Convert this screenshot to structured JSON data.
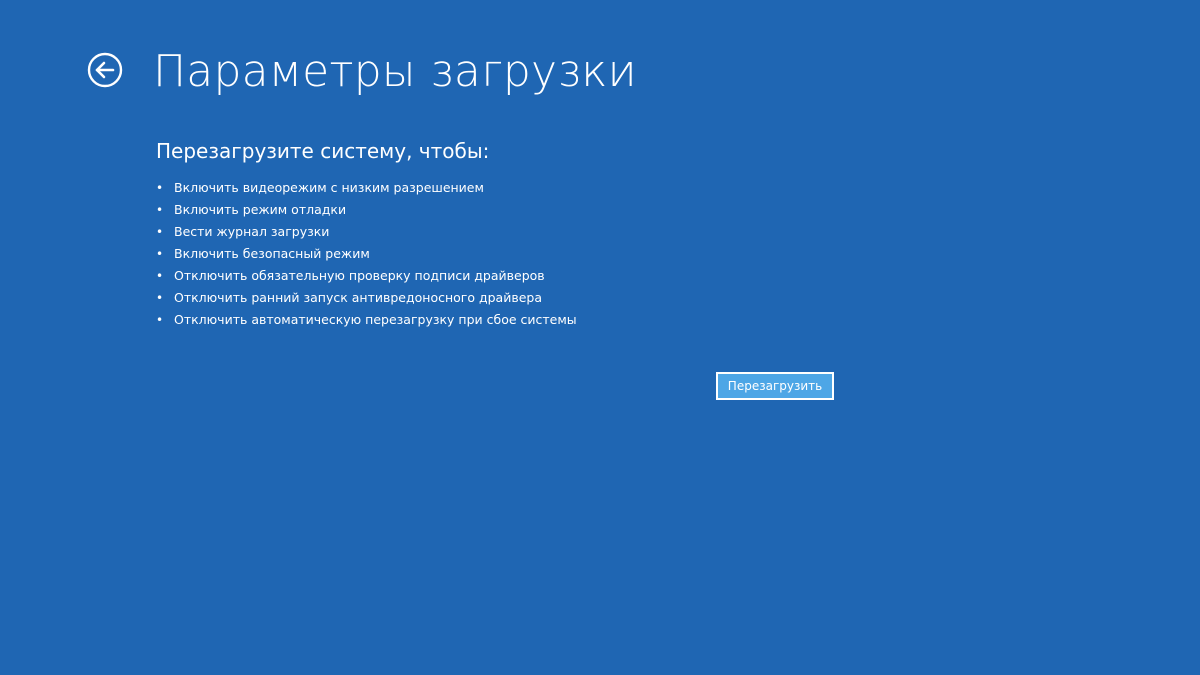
{
  "header": {
    "back_icon": "back-arrow-circle-icon",
    "title": "Параметры загрузки"
  },
  "main": {
    "subtitle": "Перезагрузите систему, чтобы:",
    "options": [
      "Включить видеорежим с низким разрешением",
      "Включить режим отладки",
      "Вести журнал загрузки",
      "Включить безопасный режим",
      "Отключить обязательную проверку подписи драйверов",
      "Отключить ранний запуск антивредоносного драйвера",
      "Отключить автоматическую перезагрузку при сбое системы"
    ],
    "restart_label": "Перезагрузить"
  },
  "colors": {
    "background": "#1f66b3",
    "text": "#ffffff",
    "button_fill": "#4da6e6",
    "button_border": "#ffffff"
  }
}
